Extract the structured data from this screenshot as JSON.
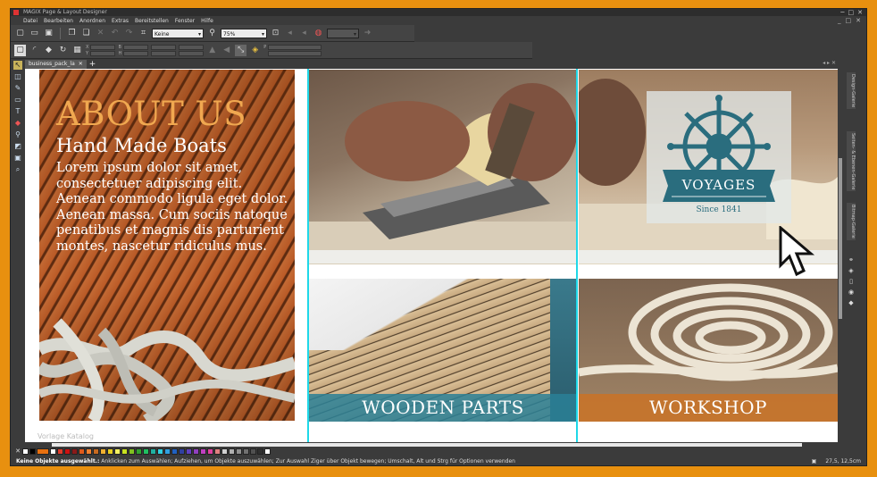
{
  "window": {
    "title": "MAGIX Page & Layout Designer",
    "buttons": [
      "─",
      "□",
      "✕"
    ]
  },
  "menu": {
    "items": [
      "Datei",
      "Bearbeiten",
      "Anordnen",
      "Extras",
      "Bereitstellen",
      "Fenster",
      "Hilfe"
    ],
    "controls": [
      "_",
      "□",
      "✕"
    ]
  },
  "toolbar1": {
    "style_combo": "Keine",
    "zoom_combo": "75%"
  },
  "toolbar2": {
    "x_label": "X",
    "y_label": "Y",
    "w_label": "B",
    "h_label": "H",
    "p_label": "P"
  },
  "document": {
    "tab_label": "business_pack_la",
    "tab_close": "✕",
    "add_tab": "+"
  },
  "page": {
    "about_title": "ABOUT US",
    "about_subtitle": "Hand Made Boats",
    "about_body": "Lorem ipsum dolor sit amet, consectetuer adipiscing elit. Aenean commodo ligula eget dolor. Aenean massa. Cum sociis natoque penatibus et magnis dis parturient montes, nascetur ridiculus mus.",
    "logo_text": "VOYAGES",
    "logo_since": "Since 1841",
    "caption_wooden": "WOODEN PARTS",
    "caption_workshop": "WORKSHOP"
  },
  "catalog_label": "Vorlage Katalog",
  "right_tabs": [
    "Design-Galerie",
    "Seiten- & Ebenen-Galerie",
    "Bitmap-Galerie"
  ],
  "palette": {
    "colors": [
      "#ffffff",
      "#000000",
      "#e03a2a",
      "#c11",
      "#8a1a1a",
      "#e05a1a",
      "#f08030",
      "#c86a20",
      "#f0b030",
      "#e8d020",
      "#f4f060",
      "#c8e020",
      "#80c020",
      "#30a030",
      "#20c060",
      "#20b0a0",
      "#30d0e0",
      "#30a0e0",
      "#2060c0",
      "#3040a0",
      "#6040c0",
      "#9040c0",
      "#c040c0",
      "#e040a0",
      "#e08080",
      "#d0d0d0",
      "#b0b0b0",
      "#909090",
      "#707070",
      "#505050",
      "#303030",
      "#ffffff"
    ]
  },
  "status": {
    "message_bold": "Keine Objekte ausgewählt.:",
    "message": " Anklicken zum Auswählen; Aufziehen, um Objekte auszuwählen; Zur Auswahl Ziger über Objekt bewegen; Umschalt, Alt und Strg für Optionen verwenden",
    "coordinates": "27,5, 12,5cm"
  }
}
